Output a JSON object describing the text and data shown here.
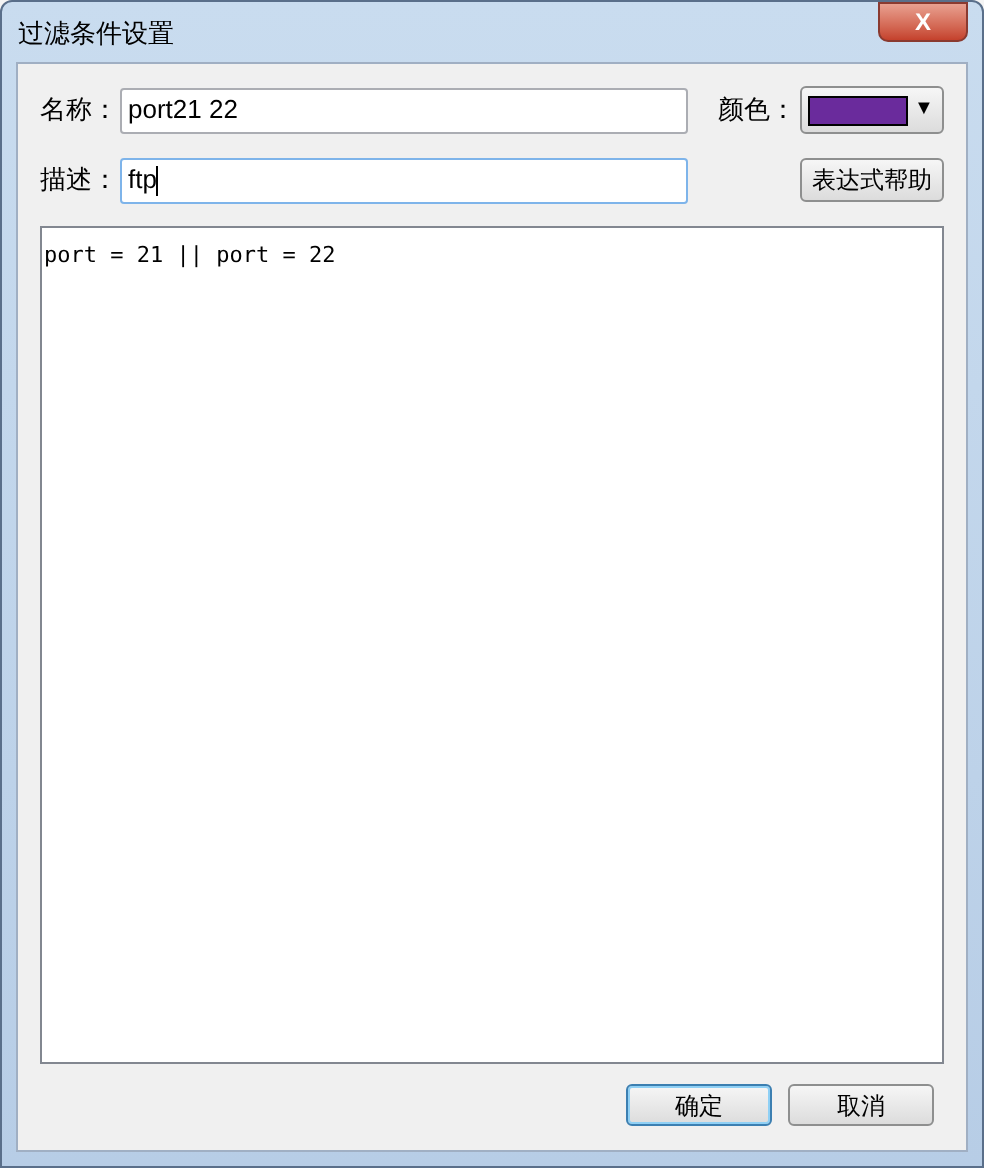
{
  "window": {
    "title": "过滤条件设置",
    "close_label": "X"
  },
  "name": {
    "label": "名称：",
    "value": "port21 22"
  },
  "color": {
    "label": "颜色：",
    "color": "#6a2b9c",
    "caret": "▼"
  },
  "description": {
    "label": "描述：",
    "value": "ftp"
  },
  "help_button": "表达式帮助",
  "expression": "port = 21 || port = 22",
  "buttons": [
    {
      "label": "确定",
      "default": true
    },
    {
      "label": "取消",
      "default": false
    }
  ]
}
